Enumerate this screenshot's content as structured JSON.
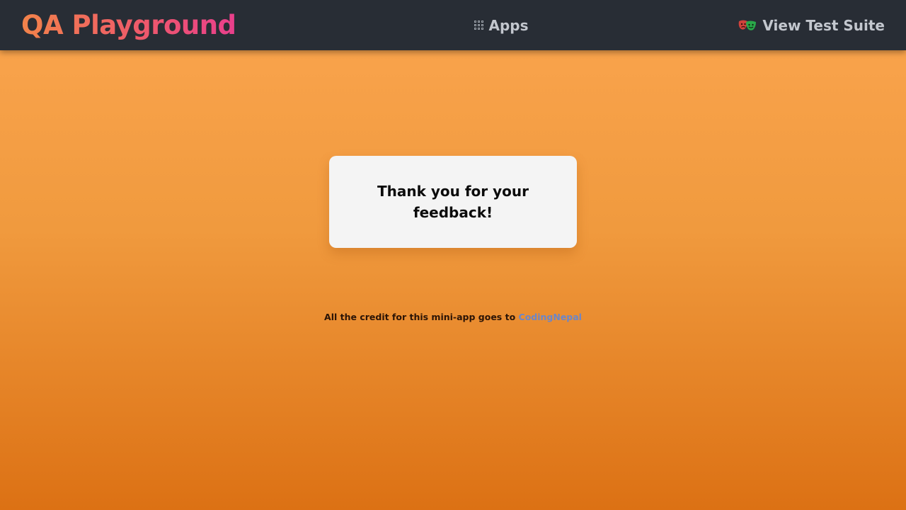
{
  "header": {
    "brand": "QA Playground",
    "apps_icon": "grid-icon",
    "apps_label": "Apps",
    "suite_icon": "playwright-masks-icon",
    "suite_label": "View Test Suite"
  },
  "card": {
    "message": "Thank you for your feedback!"
  },
  "footer": {
    "credit_text": "All the credit for this mini-app goes to",
    "credit_link": "CodingNepal"
  },
  "colors": {
    "navbar_bg": "#282d35",
    "brand_gradient_start": "#f2834a",
    "brand_gradient_end": "#e93f8c",
    "page_bg_top": "#fba54f",
    "page_bg_bottom": "#dc7114",
    "card_bg": "#f4f4f4",
    "link": "#6b86c9"
  }
}
